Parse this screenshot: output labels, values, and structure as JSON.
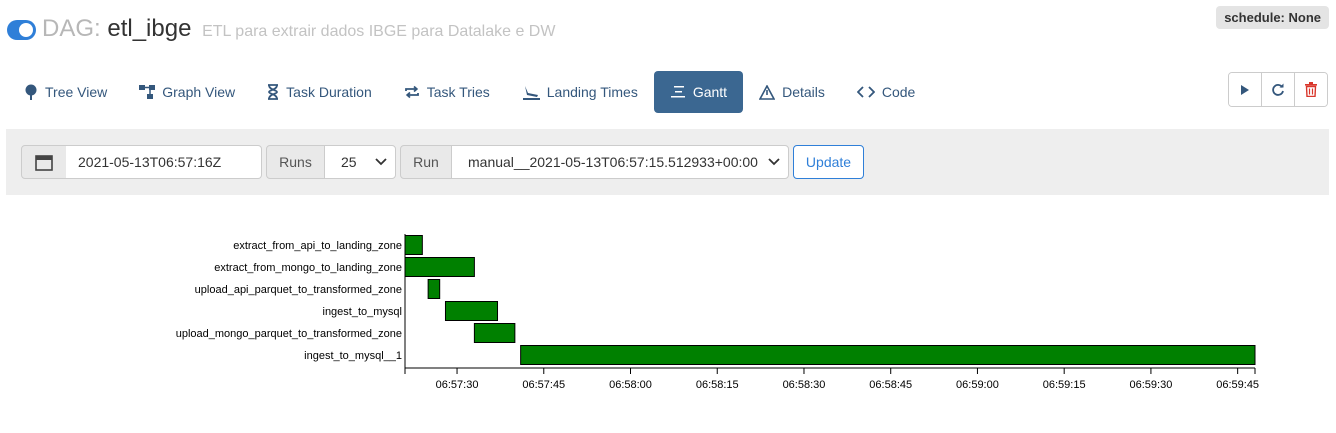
{
  "header": {
    "dag_label": "DAG:",
    "dag_id": "etl_ibge",
    "description": "ETL para extrair dados IBGE para Datalake e DW",
    "schedule": "schedule: None",
    "dag_enabled": true
  },
  "tabs": [
    {
      "label": "Tree View",
      "icon": "tree-icon",
      "active": false
    },
    {
      "label": "Graph View",
      "icon": "graph-icon",
      "active": false
    },
    {
      "label": "Task Duration",
      "icon": "hourglass-icon",
      "active": false
    },
    {
      "label": "Task Tries",
      "icon": "repeat-icon",
      "active": false
    },
    {
      "label": "Landing Times",
      "icon": "plane-landing-icon",
      "active": false
    },
    {
      "label": "Gantt",
      "icon": "gantt-icon",
      "active": true
    },
    {
      "label": "Details",
      "icon": "warning-triangle-icon",
      "active": false
    },
    {
      "label": "Code",
      "icon": "code-icon",
      "active": false
    }
  ],
  "actions": [
    {
      "name": "trigger-dag-button",
      "icon": "play-icon"
    },
    {
      "name": "refresh-button",
      "icon": "refresh-icon"
    },
    {
      "name": "delete-dag-button",
      "icon": "trash-icon"
    }
  ],
  "filter": {
    "base_date": "2021-05-13T06:57:16Z",
    "runs_label": "Runs",
    "runs_value": "25",
    "run_label": "Run",
    "run_value": "manual__2021-05-13T06:57:15.512933+00:00",
    "update_label": "Update"
  },
  "colors": {
    "bar_fill": "#008000",
    "active_tab": "#3b6791",
    "link": "#34577c",
    "delete": "#d9362b"
  },
  "chart_data": {
    "type": "gantt",
    "x_axis_start": "06:57:21",
    "x_axis_end": "06:59:48",
    "x_ticks": [
      "06:57:30",
      "06:57:45",
      "06:58:00",
      "06:58:15",
      "06:58:30",
      "06:58:45",
      "06:59:00",
      "06:59:15",
      "06:59:30",
      "06:59:45"
    ],
    "tasks": [
      {
        "name": "extract_from_api_to_landing_zone",
        "start": "06:57:21",
        "end": "06:57:24"
      },
      {
        "name": "extract_from_mongo_to_landing_zone",
        "start": "06:57:21",
        "end": "06:57:33"
      },
      {
        "name": "upload_api_parquet_to_transformed_zone",
        "start": "06:57:25",
        "end": "06:57:27"
      },
      {
        "name": "ingest_to_mysql",
        "start": "06:57:28",
        "end": "06:57:37"
      },
      {
        "name": "upload_mongo_parquet_to_transformed_zone",
        "start": "06:57:33",
        "end": "06:57:40"
      },
      {
        "name": "ingest_to_mysql__1",
        "start": "06:57:41",
        "end": "06:59:48"
      }
    ]
  }
}
